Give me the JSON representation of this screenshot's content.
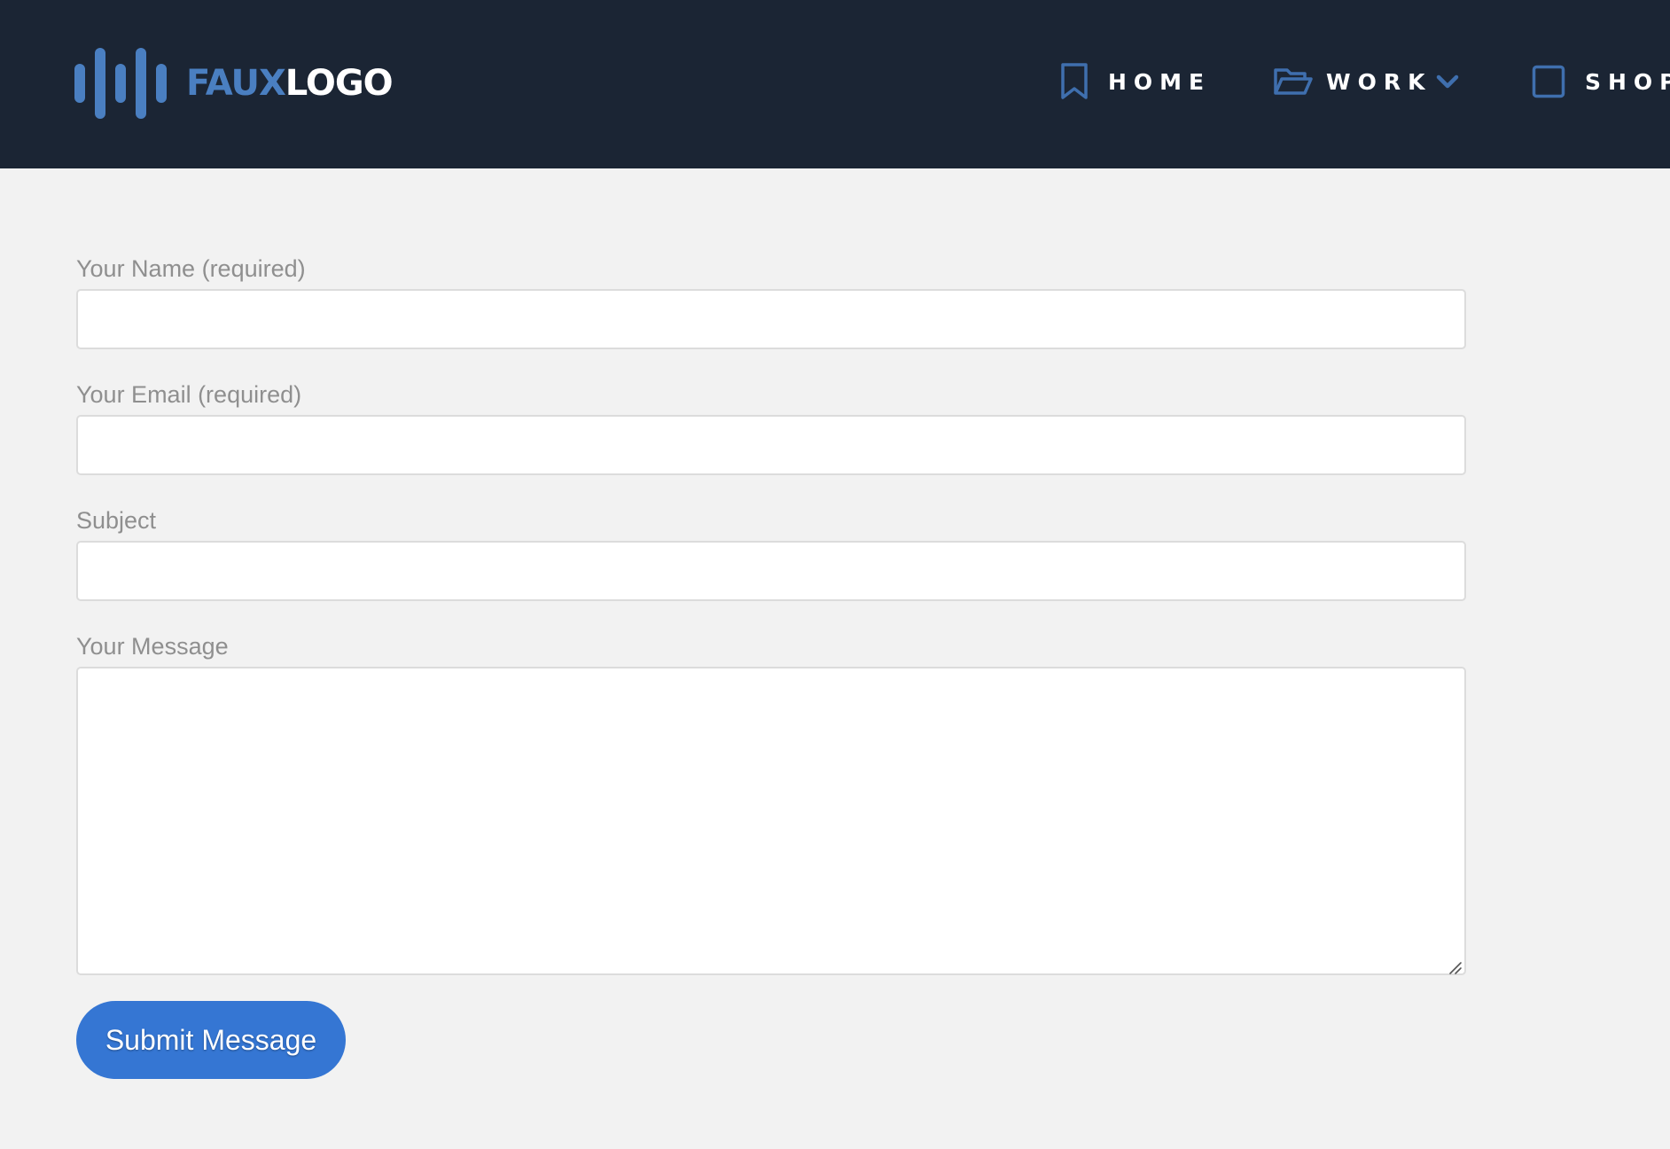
{
  "header": {
    "logo": {
      "part1": "FAUX",
      "part2": "LOGO",
      "icon": "sound-bars-icon"
    },
    "nav": [
      {
        "label": "HOME",
        "icon": "bookmark-icon"
      },
      {
        "label": "WORK",
        "icon": "folder-open-icon",
        "dropdown_icon": "chevron-down-icon"
      },
      {
        "label": "SHOP",
        "icon": "square-icon"
      }
    ]
  },
  "form": {
    "fields": [
      {
        "label": "Your Name (required)",
        "value": "",
        "placeholder": ""
      },
      {
        "label": "Your Email (required)",
        "value": "",
        "placeholder": ""
      },
      {
        "label": "Subject",
        "value": "",
        "placeholder": ""
      },
      {
        "label": "Your Message",
        "value": "",
        "placeholder": ""
      }
    ],
    "submit_label": "Submit Message"
  },
  "colors": {
    "header_bg": "#1b2534",
    "accent": "#4a7fc1",
    "button": "#3576d3",
    "page_bg": "#f2f2f2",
    "label": "#8f8f8f"
  }
}
